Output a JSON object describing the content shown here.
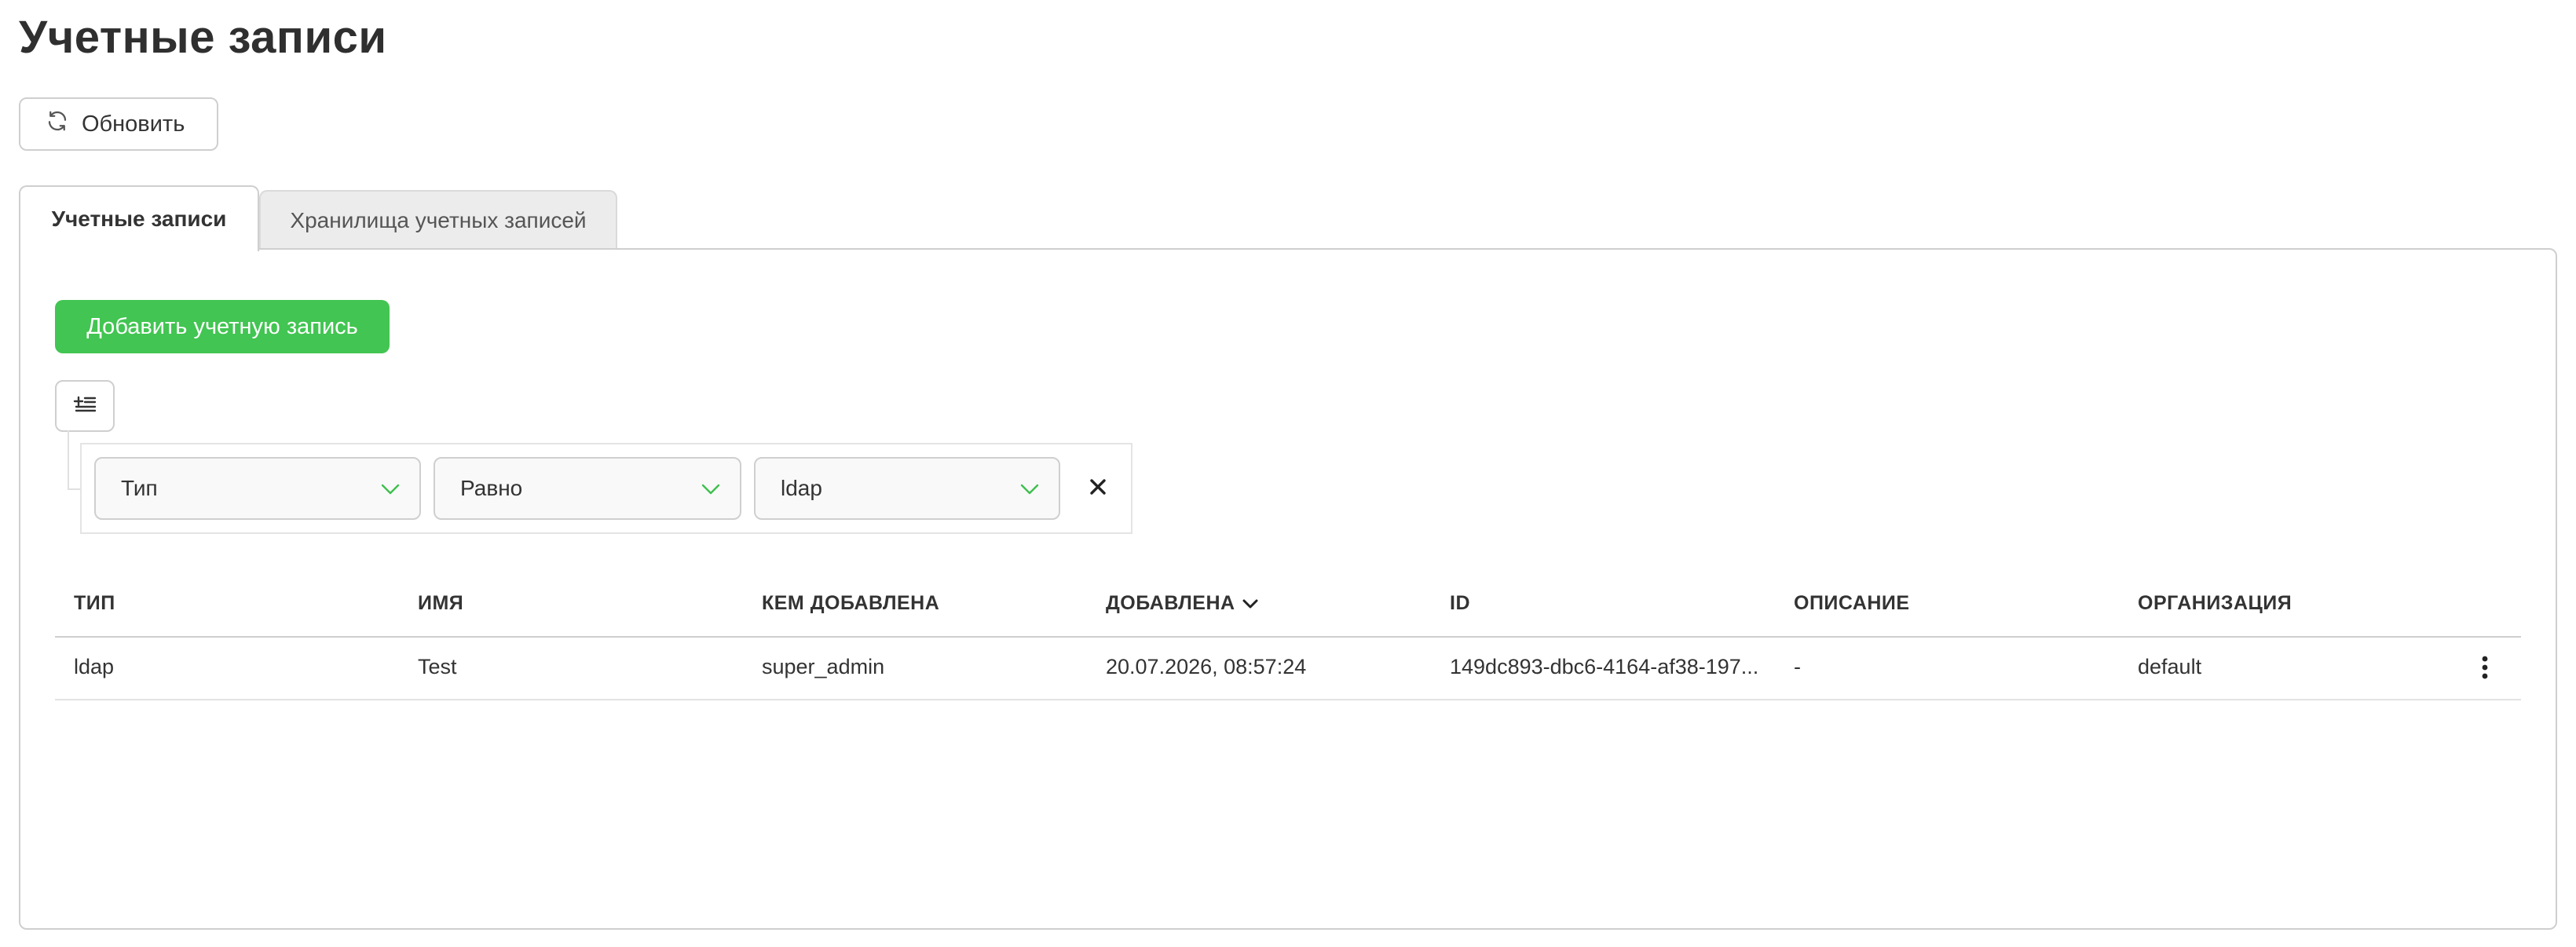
{
  "page": {
    "title": "Учетные записи",
    "refresh_label": "Обновить"
  },
  "tabs": [
    {
      "label": "Учетные записи",
      "active": true
    },
    {
      "label": "Хранилища учетных записей",
      "active": false
    }
  ],
  "actions": {
    "add_label": "Добавить учетную запись"
  },
  "filter": {
    "field": "Тип",
    "operator": "Равно",
    "value": "ldap"
  },
  "table": {
    "columns": [
      "ТИП",
      "ИМЯ",
      "КЕМ ДОБАВЛЕНА",
      "ДОБАВЛЕНА",
      "ID",
      "ОПИСАНИЕ",
      "ОРГАНИЗАЦИЯ"
    ],
    "sorted_column": "ДОБАВЛЕНА",
    "sort_direction": "desc",
    "rows": [
      {
        "type": "ldap",
        "name": "Test",
        "added_by": "super_admin",
        "added": "20.07.2026, 08:57:24",
        "id": "149dc893-dbc6-4164-af38-197...",
        "description": "-",
        "organization": "default"
      }
    ]
  },
  "colors": {
    "accent_green": "#42c552",
    "border": "#cfcfcf",
    "chevron": "#3fbf4f"
  },
  "icons": {
    "refresh": "refresh-icon",
    "filter_add": "filter-add-icon",
    "chevron": "chevron-down-icon",
    "remove": "close-icon",
    "sort": "sort-desc-icon",
    "row_menu": "more-vertical-icon"
  }
}
